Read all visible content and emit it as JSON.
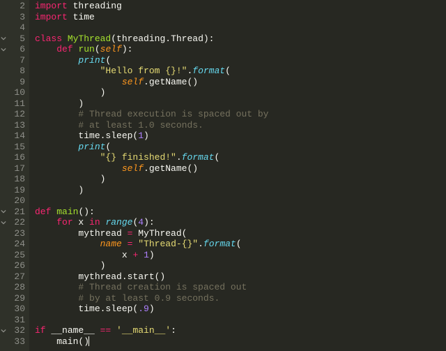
{
  "editor": {
    "language": "python",
    "first_line_number": 2,
    "foldable_lines": [
      5,
      6,
      21,
      22,
      32
    ],
    "lines": [
      {
        "n": 2,
        "tokens": [
          [
            "kw",
            "import"
          ],
          [
            "id",
            " threading"
          ]
        ]
      },
      {
        "n": 3,
        "tokens": [
          [
            "kw",
            "import"
          ],
          [
            "id",
            " time"
          ]
        ]
      },
      {
        "n": 4,
        "tokens": []
      },
      {
        "n": 5,
        "tokens": [
          [
            "kw",
            "class"
          ],
          [
            "id",
            " "
          ],
          [
            "cls",
            "MyThread"
          ],
          [
            "id",
            "(threading.Thread):"
          ]
        ]
      },
      {
        "n": 6,
        "tokens": [
          [
            "id",
            "    "
          ],
          [
            "kw",
            "def"
          ],
          [
            "id",
            " "
          ],
          [
            "fn",
            "run"
          ],
          [
            "id",
            "("
          ],
          [
            "param",
            "self"
          ],
          [
            "id",
            "):"
          ]
        ]
      },
      {
        "n": 7,
        "tokens": [
          [
            "id",
            "        "
          ],
          [
            "kw2",
            "print"
          ],
          [
            "id",
            "("
          ]
        ]
      },
      {
        "n": 8,
        "tokens": [
          [
            "id",
            "            "
          ],
          [
            "str",
            "\"Hello from {}!\""
          ],
          [
            "id",
            "."
          ],
          [
            "kw2",
            "format"
          ],
          [
            "id",
            "("
          ]
        ]
      },
      {
        "n": 9,
        "tokens": [
          [
            "id",
            "                "
          ],
          [
            "param",
            "self"
          ],
          [
            "id",
            ".getName()"
          ]
        ]
      },
      {
        "n": 10,
        "tokens": [
          [
            "id",
            "            )"
          ]
        ]
      },
      {
        "n": 11,
        "tokens": [
          [
            "id",
            "        )"
          ]
        ]
      },
      {
        "n": 12,
        "tokens": [
          [
            "id",
            "        "
          ],
          [
            "cmt",
            "# Thread execution is spaced out by"
          ]
        ]
      },
      {
        "n": 13,
        "tokens": [
          [
            "id",
            "        "
          ],
          [
            "cmt",
            "# at least 1.0 seconds."
          ]
        ]
      },
      {
        "n": 14,
        "tokens": [
          [
            "id",
            "        time.sleep("
          ],
          [
            "num",
            "1"
          ],
          [
            "id",
            ")"
          ]
        ]
      },
      {
        "n": 15,
        "tokens": [
          [
            "id",
            "        "
          ],
          [
            "kw2",
            "print"
          ],
          [
            "id",
            "("
          ]
        ]
      },
      {
        "n": 16,
        "tokens": [
          [
            "id",
            "            "
          ],
          [
            "str",
            "\"{} finished!\""
          ],
          [
            "id",
            "."
          ],
          [
            "kw2",
            "format"
          ],
          [
            "id",
            "("
          ]
        ]
      },
      {
        "n": 17,
        "tokens": [
          [
            "id",
            "                "
          ],
          [
            "param",
            "self"
          ],
          [
            "id",
            ".getName()"
          ]
        ]
      },
      {
        "n": 18,
        "tokens": [
          [
            "id",
            "            )"
          ]
        ]
      },
      {
        "n": 19,
        "tokens": [
          [
            "id",
            "        )"
          ]
        ]
      },
      {
        "n": 20,
        "tokens": []
      },
      {
        "n": 21,
        "tokens": [
          [
            "kw",
            "def"
          ],
          [
            "id",
            " "
          ],
          [
            "fn",
            "main"
          ],
          [
            "id",
            "():"
          ]
        ]
      },
      {
        "n": 22,
        "tokens": [
          [
            "id",
            "    "
          ],
          [
            "kw",
            "for"
          ],
          [
            "id",
            " x "
          ],
          [
            "kw",
            "in"
          ],
          [
            "id",
            " "
          ],
          [
            "kw2",
            "range"
          ],
          [
            "id",
            "("
          ],
          [
            "num",
            "4"
          ],
          [
            "id",
            "):"
          ]
        ]
      },
      {
        "n": 23,
        "tokens": [
          [
            "id",
            "        mythread "
          ],
          [
            "kw",
            "="
          ],
          [
            "id",
            " MyThread("
          ]
        ]
      },
      {
        "n": 24,
        "tokens": [
          [
            "id",
            "            "
          ],
          [
            "param",
            "name"
          ],
          [
            "id",
            " "
          ],
          [
            "kw",
            "="
          ],
          [
            "id",
            " "
          ],
          [
            "str",
            "\"Thread-{}\""
          ],
          [
            "id",
            "."
          ],
          [
            "kw2",
            "format"
          ],
          [
            "id",
            "("
          ]
        ]
      },
      {
        "n": 25,
        "tokens": [
          [
            "id",
            "                x "
          ],
          [
            "kw",
            "+"
          ],
          [
            "id",
            " "
          ],
          [
            "num",
            "1"
          ],
          [
            "id",
            ")"
          ]
        ]
      },
      {
        "n": 26,
        "tokens": [
          [
            "id",
            "            )"
          ]
        ]
      },
      {
        "n": 27,
        "tokens": [
          [
            "id",
            "        mythread.start()"
          ]
        ]
      },
      {
        "n": 28,
        "tokens": [
          [
            "id",
            "        "
          ],
          [
            "cmt",
            "# Thread creation is spaced out"
          ]
        ]
      },
      {
        "n": 29,
        "tokens": [
          [
            "id",
            "        "
          ],
          [
            "cmt",
            "# by at least 0.9 seconds."
          ]
        ]
      },
      {
        "n": 30,
        "tokens": [
          [
            "id",
            "        time.sleep("
          ],
          [
            "num",
            ".9"
          ],
          [
            "id",
            ")"
          ]
        ]
      },
      {
        "n": 31,
        "tokens": []
      },
      {
        "n": 32,
        "tokens": [
          [
            "kw",
            "if"
          ],
          [
            "id",
            " __name__ "
          ],
          [
            "kw",
            "=="
          ],
          [
            "id",
            " "
          ],
          [
            "str",
            "'__main__'"
          ],
          [
            "id",
            ":"
          ]
        ]
      },
      {
        "n": 33,
        "tokens": [
          [
            "id",
            "    main()"
          ]
        ],
        "cursor_after": true
      }
    ]
  }
}
